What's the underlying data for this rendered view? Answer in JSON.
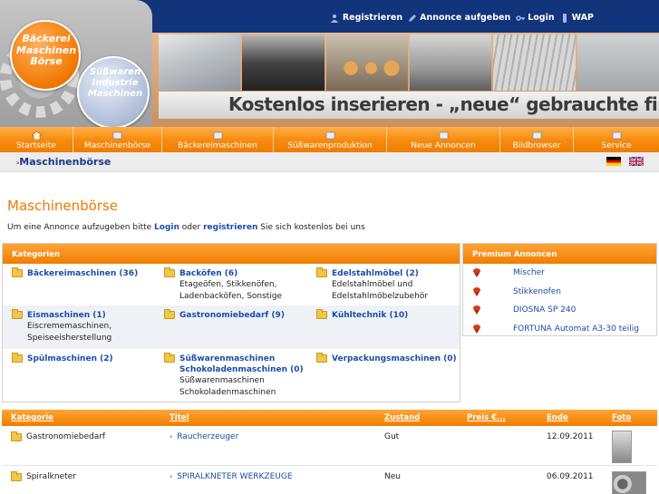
{
  "header": {
    "logo_line1": "Bäckerei",
    "logo_line2": "Maschinen",
    "logo_line3": "Börse",
    "sublogo_line1": "Süßwaren",
    "sublogo_line2": "Industrie",
    "sublogo_line3": "Maschinen",
    "slogan": "Kostenlos inserieren - „neue“ gebrauchte finden!",
    "toplinks": [
      {
        "label": "Registrieren",
        "icon": "user-add-icon"
      },
      {
        "label": "Annonce aufgeben",
        "icon": "pencil-icon"
      },
      {
        "label": "Login",
        "icon": "key-icon"
      },
      {
        "label": "WAP",
        "icon": "phone-icon"
      }
    ]
  },
  "nav": {
    "items": [
      {
        "label": "Startseite",
        "icon": "home-icon"
      },
      {
        "label": "Maschinenbörse",
        "icon": "nav-icon"
      },
      {
        "label": "Bäckereimaschinen",
        "icon": "nav-icon"
      },
      {
        "label": "Süßwarenproduktion",
        "icon": "nav-icon"
      },
      {
        "label": "Neue Annoncen",
        "icon": "nav-icon"
      },
      {
        "label": "Bildbrowser",
        "icon": "nav-icon"
      },
      {
        "label": "Service",
        "icon": "nav-icon"
      }
    ]
  },
  "breadcrumb": "Maschinenbörse",
  "page": {
    "title": "Maschinenbörse",
    "intro_before": "Um eine Annonce aufzugeben bitte ",
    "intro_login": "Login",
    "intro_mid": " oder ",
    "intro_register": "registrieren",
    "intro_after": " Sie sich kostenlos bei uns"
  },
  "categories": {
    "heading": "Kategorien",
    "rows": [
      [
        {
          "title": "Bäckereimaschinen (36)",
          "sub": ""
        },
        {
          "title": "Backöfen (6)",
          "sub": "Etageöfen, Stikkenöfen, Ladenbacköfen, Sonstige"
        },
        {
          "title": "Edelstahlmöbel (2)",
          "sub": "Edelstahlmöbel und Edelstahlmöbelzubehör"
        }
      ],
      [
        {
          "title": "Eismaschinen (1)",
          "sub": "Eiscrememaschinen, Speiseeisherstellung"
        },
        {
          "title": "Gastronomiebedarf (9)",
          "sub": ""
        },
        {
          "title": "Kühltechnik (10)",
          "sub": ""
        }
      ],
      [
        {
          "title": "Spülmaschinen (2)",
          "sub": ""
        },
        {
          "title": "Süßwarenmaschinen Schokoladenmaschinen (0)",
          "sub": "Süßwarenmaschinen Schokoladenmaschinen"
        },
        {
          "title": "Verpackungsmaschinen (0)",
          "sub": ""
        }
      ]
    ]
  },
  "premium": {
    "heading": "Premium Annoncen",
    "items": [
      "Mischer",
      "Stikkenofen",
      "DIOSNA SP 240",
      "FORTUNA Automat A3-30 teilig"
    ]
  },
  "listing": {
    "columns": [
      "Kategorie",
      "Titel",
      "Zustand",
      "Preis €...",
      "Ende",
      "Foto"
    ],
    "rows": [
      {
        "kategorie": "Gastronomiebedarf",
        "titel": "Raucherzeuger",
        "zustand": "Gut",
        "preis": "",
        "ende": "12.09.2011"
      },
      {
        "kategorie": "Spiralkneter",
        "titel": "SPIRALKNETER WERKZEUGE",
        "zustand": "Neu",
        "preis": "",
        "ende": "06.09.2011"
      }
    ]
  },
  "colors": {
    "orange": "#f07e00",
    "navy": "#12347a",
    "link": "#1b4ca8"
  }
}
